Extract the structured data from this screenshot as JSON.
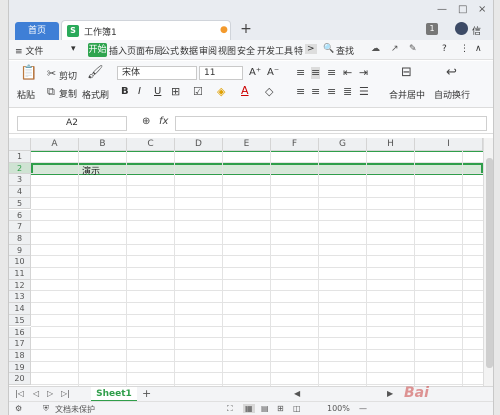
{
  "titlebar": {
    "home_tab": "首页",
    "doc_icon": "S",
    "doc_title": "工作簿1",
    "unsaved_dot": "●",
    "new_tab": "+",
    "badge": "1",
    "user": "信",
    "win_controls": [
      "—",
      "□",
      "×"
    ]
  },
  "menubar": {
    "items": [
      "≡ 文件",
      "▾",
      "开始",
      "插入",
      "页面布局",
      "公式",
      "数据",
      "审阅",
      "视图",
      "安全",
      "开发工具",
      "特"
    ],
    "more": ">",
    "search": "查找",
    "help": "?",
    "more_dots": "⋮",
    "collapse": "∧"
  },
  "ribbon": {
    "paste": "粘贴",
    "cut": "剪切",
    "copy": "复制",
    "format_painter": "格式刷",
    "font_name": "宋体",
    "font_size": "11",
    "grow": "A⁺",
    "shrink": "A⁻",
    "bold": "B",
    "italic": "I",
    "underline": "U",
    "merge": "合并居中",
    "wrap": "自动换行"
  },
  "formula_bar": {
    "name_box": "A2",
    "fx": "fx",
    "value": ""
  },
  "grid": {
    "columns": [
      "A",
      "B",
      "C",
      "D",
      "E",
      "F",
      "G",
      "H",
      "I"
    ],
    "rows": [
      "1",
      "2",
      "3",
      "4",
      "5",
      "6",
      "7",
      "8",
      "9",
      "10",
      "11",
      "12",
      "13",
      "14",
      "15",
      "16",
      "17",
      "18",
      "19",
      "20"
    ],
    "selected_row": "2",
    "cell_b2": "演示"
  },
  "sheets": {
    "tabs": [
      "Sheet1"
    ],
    "add": "+"
  },
  "status": {
    "protect": "文档未保护",
    "zoom": "100%",
    "zoom_minus": "—"
  },
  "colors": {
    "accent": "#2f9e4a",
    "home_tab": "#3f7fd6",
    "selection_fill": "#d7e8d9"
  },
  "watermark": "Bai"
}
